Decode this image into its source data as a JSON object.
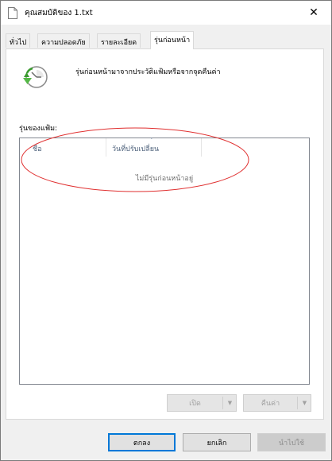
{
  "window": {
    "title": "คุณสมบัติของ 1.txt",
    "close_glyph": "✕"
  },
  "tabs": [
    {
      "label": "ทั่วไป",
      "active": false
    },
    {
      "label": "ความปลอดภัย",
      "active": false
    },
    {
      "label": "รายละเอียด",
      "active": false
    },
    {
      "label": "รุ่นก่อนหน้า",
      "active": true
    }
  ],
  "previous_versions": {
    "description": "รุ่นก่อนหน้ามาจากประวัติแฟ้มหรือจากจุดคืนค่า",
    "versions_label": "รุ่นของแฟ้ม:",
    "columns": [
      "ชื่อ",
      "วันที่ปรับเปลี่ยน"
    ],
    "empty_message": "ไม่มีรุ่นก่อนหน้าอยู่",
    "open_button": "เปิด",
    "restore_button": "คืนค่า"
  },
  "footer": {
    "ok": "ตกลง",
    "cancel": "ยกเลิก",
    "apply": "นำไปใช้"
  },
  "colors": {
    "annotation": "#e03030",
    "accent": "#0078d7"
  },
  "icons": {
    "title": "document-icon",
    "history": "clock-restore-icon"
  }
}
